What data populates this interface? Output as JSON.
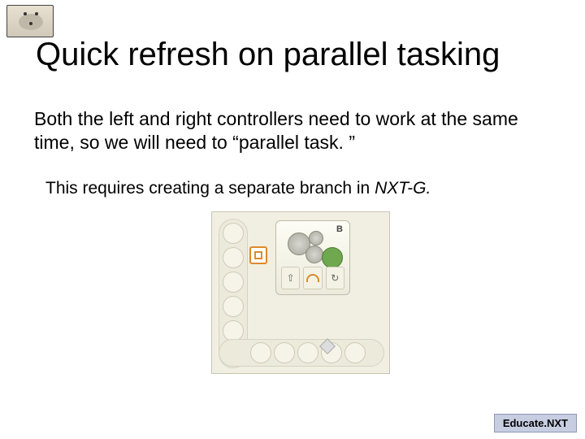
{
  "title": "Quick refresh on parallel tasking",
  "paragraph1": "Both the left and right controllers need to work at the same time, so we will need to “parallel task. ”",
  "paragraph2_pre": "This requires creating a separate branch in ",
  "paragraph2_em": "NXT-G.",
  "diagram": {
    "motor_port_label": "B",
    "arrow_up": "⇧",
    "power_icon": "↻"
  },
  "footer": "Educate.NXT"
}
